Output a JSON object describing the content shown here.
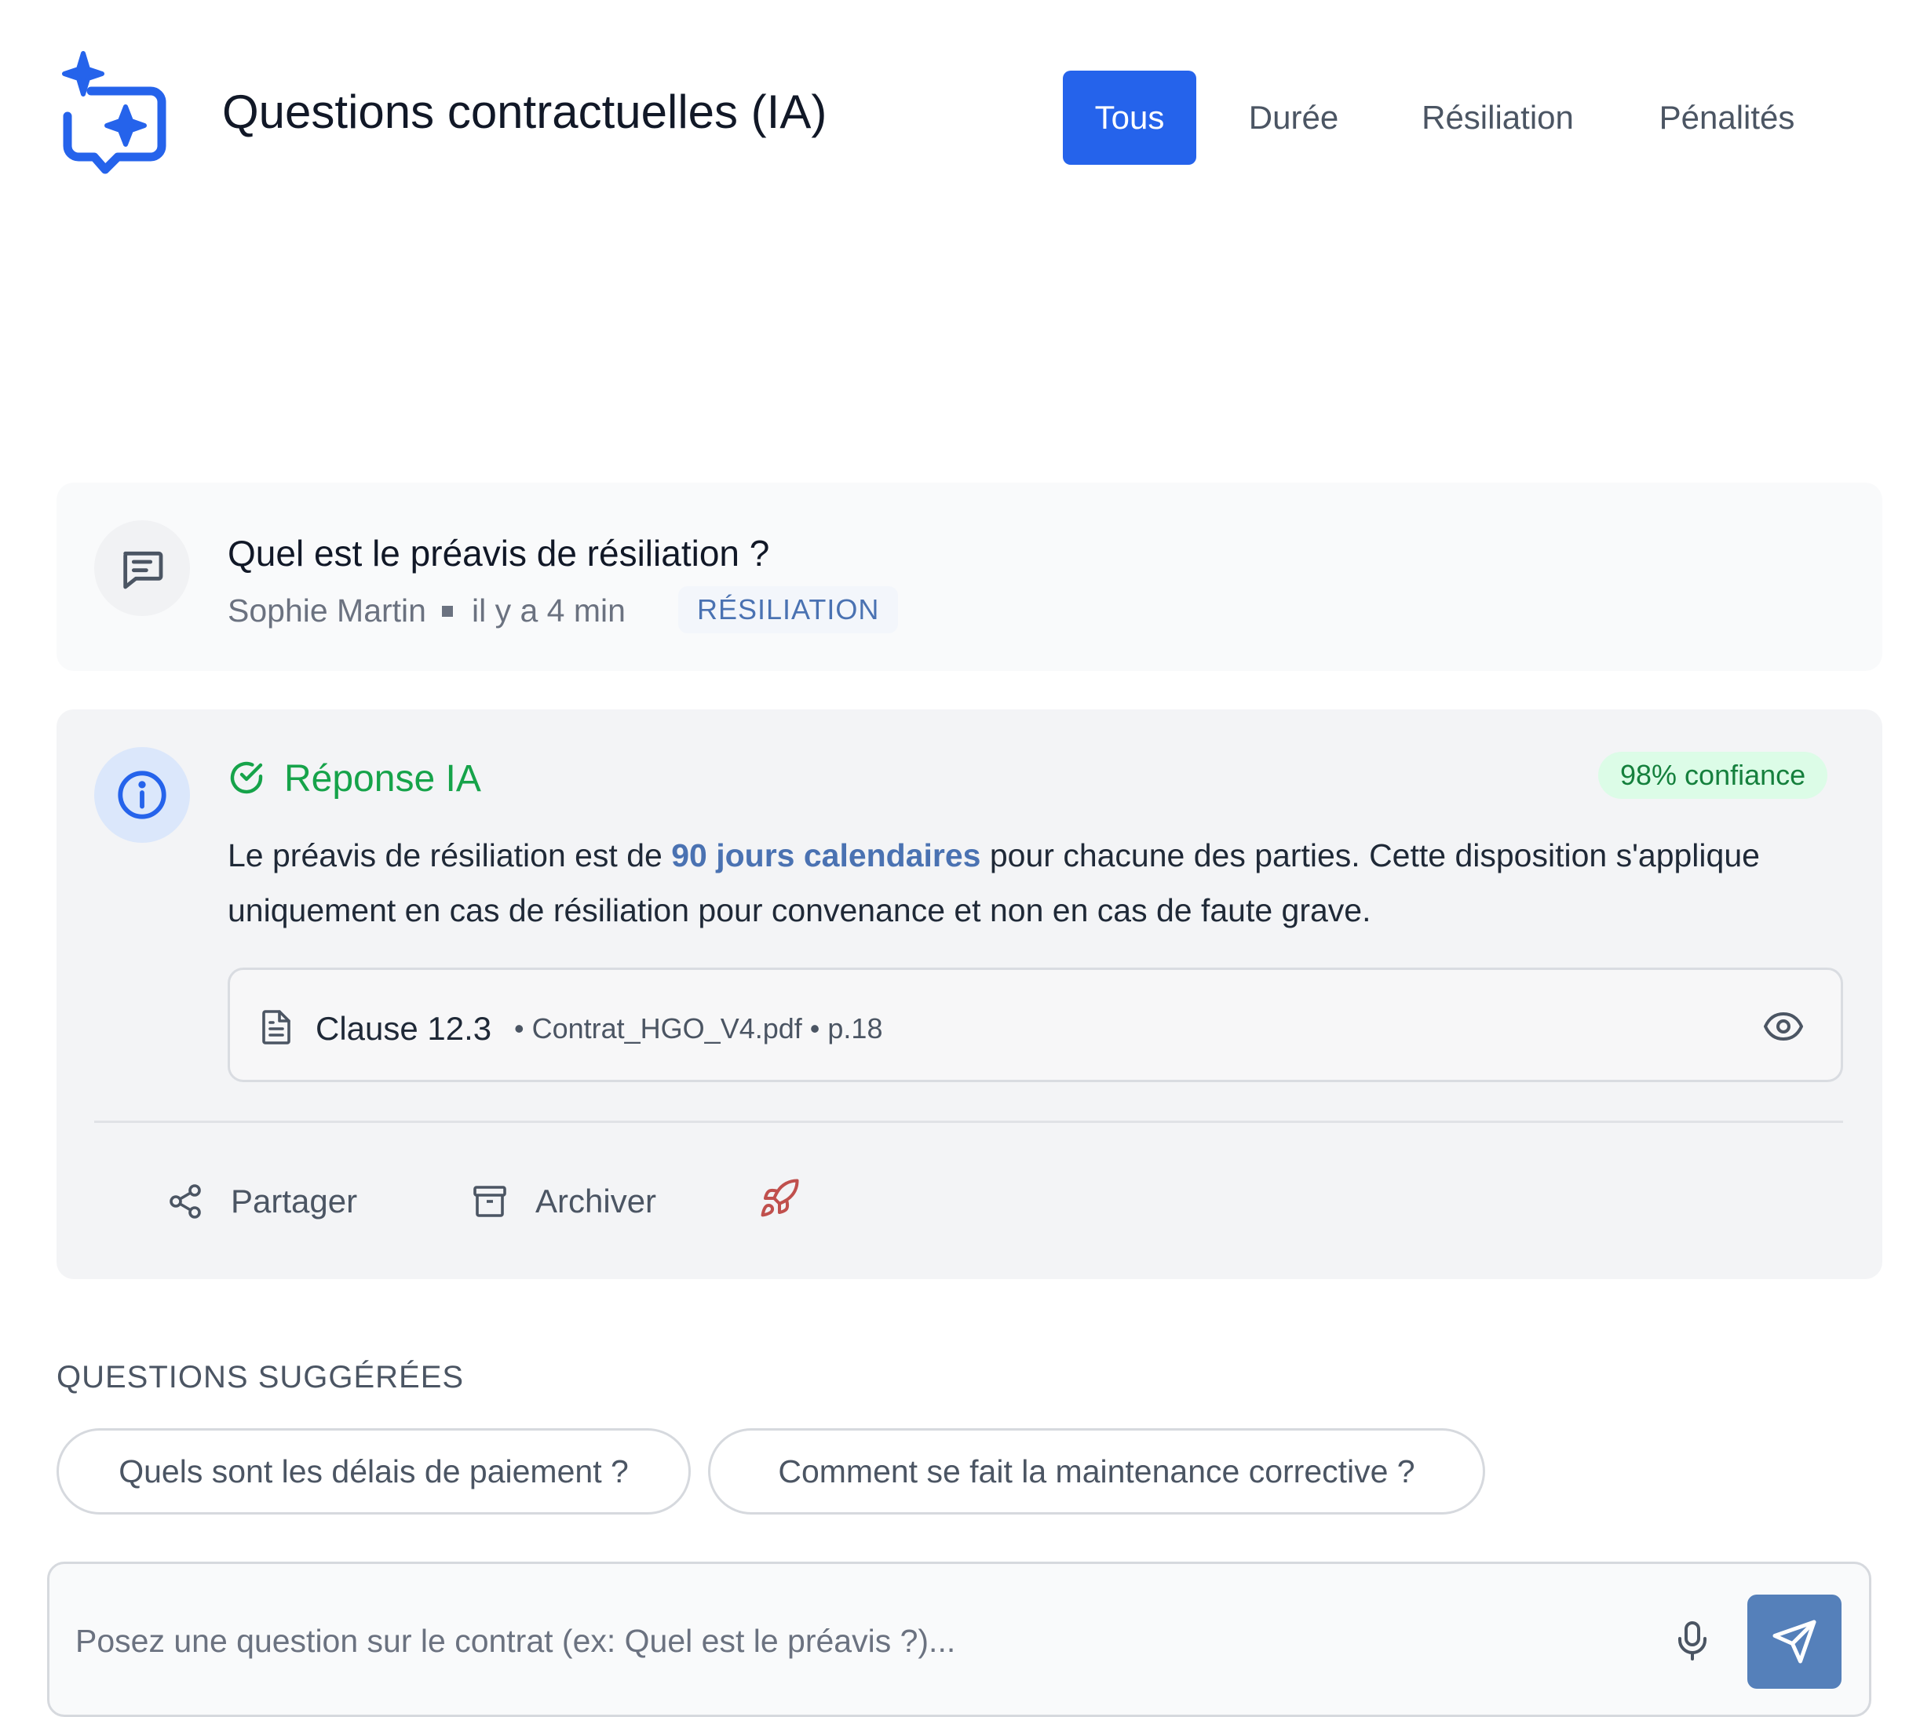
{
  "header": {
    "title": "Questions contractuelles (IA)",
    "tabs": [
      {
        "label": "Tous",
        "active": true
      },
      {
        "label": "Durée",
        "active": false
      },
      {
        "label": "Résiliation",
        "active": false
      },
      {
        "label": "Pénalités",
        "active": false
      }
    ]
  },
  "question": {
    "text": "Quel est le préavis de résiliation ?",
    "author": "Sophie Martin",
    "time": "il y a 4 min",
    "tag": "RÉSILIATION"
  },
  "answer": {
    "title": "Réponse IA",
    "confidence": "98% confiance",
    "body_before": "Le préavis de résiliation est de ",
    "body_highlight": "90 jours calendaires",
    "body_after": " pour chacune des parties. Cette disposition s'applique uniquement en cas de résiliation pour convenance et non en cas de faute grave.",
    "source": {
      "clause": "Clause 12.3",
      "meta": "• Contrat_HGO_V4.pdf • p.18"
    },
    "actions": {
      "share": "Partager",
      "archive": "Archiver"
    }
  },
  "suggestions": {
    "title": "QUESTIONS SUGGÉRÉES",
    "items": [
      "Quels sont les délais de paiement ?",
      "Comment se fait la maintenance corrective ?"
    ]
  },
  "input": {
    "placeholder": "Posez une question sur le contrat (ex: Quel est le préavis ?)...",
    "value": ""
  },
  "colors": {
    "accent": "#2563eb",
    "success": "#16a34a",
    "highlight": "#4a72b2",
    "send_button": "#5580ba",
    "rocket": "#c0504d"
  },
  "icons": [
    "ai-chat-sparkle-logo-icon",
    "message-icon",
    "info-icon",
    "check-circle-icon",
    "document-icon",
    "eye-icon",
    "share-icon",
    "archive-icon",
    "rocket-icon",
    "microphone-icon",
    "send-icon"
  ]
}
